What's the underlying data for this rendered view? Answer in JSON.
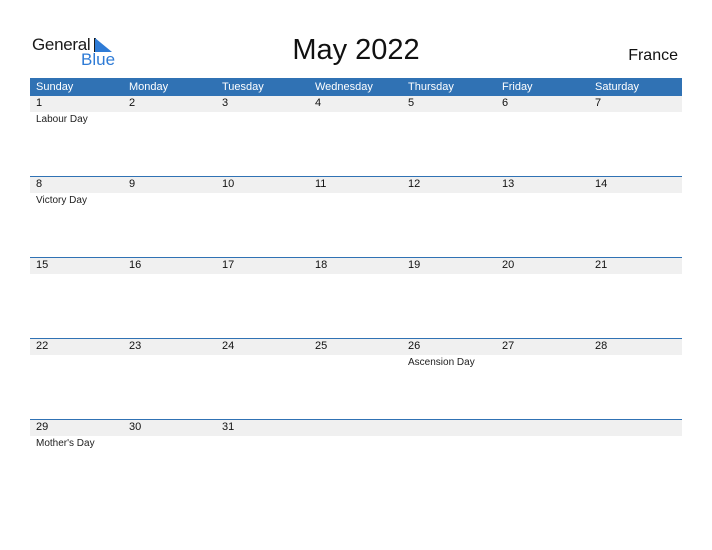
{
  "logo": {
    "line1": "General",
    "line2": "Blue"
  },
  "title": "May 2022",
  "country": "France",
  "colors": {
    "header_bg": "#3072b4",
    "accent": "#2e7bd6",
    "day_row_bg": "#f0f0f0"
  },
  "weekdays": [
    "Sunday",
    "Monday",
    "Tuesday",
    "Wednesday",
    "Thursday",
    "Friday",
    "Saturday"
  ],
  "weeks": [
    [
      {
        "day": "1",
        "event": "Labour Day"
      },
      {
        "day": "2",
        "event": ""
      },
      {
        "day": "3",
        "event": ""
      },
      {
        "day": "4",
        "event": ""
      },
      {
        "day": "5",
        "event": ""
      },
      {
        "day": "6",
        "event": ""
      },
      {
        "day": "7",
        "event": ""
      }
    ],
    [
      {
        "day": "8",
        "event": "Victory Day"
      },
      {
        "day": "9",
        "event": ""
      },
      {
        "day": "10",
        "event": ""
      },
      {
        "day": "11",
        "event": ""
      },
      {
        "day": "12",
        "event": ""
      },
      {
        "day": "13",
        "event": ""
      },
      {
        "day": "14",
        "event": ""
      }
    ],
    [
      {
        "day": "15",
        "event": ""
      },
      {
        "day": "16",
        "event": ""
      },
      {
        "day": "17",
        "event": ""
      },
      {
        "day": "18",
        "event": ""
      },
      {
        "day": "19",
        "event": ""
      },
      {
        "day": "20",
        "event": ""
      },
      {
        "day": "21",
        "event": ""
      }
    ],
    [
      {
        "day": "22",
        "event": ""
      },
      {
        "day": "23",
        "event": ""
      },
      {
        "day": "24",
        "event": ""
      },
      {
        "day": "25",
        "event": ""
      },
      {
        "day": "26",
        "event": "Ascension Day"
      },
      {
        "day": "27",
        "event": ""
      },
      {
        "day": "28",
        "event": ""
      }
    ],
    [
      {
        "day": "29",
        "event": "Mother's Day"
      },
      {
        "day": "30",
        "event": ""
      },
      {
        "day": "31",
        "event": ""
      },
      {
        "day": "",
        "event": ""
      },
      {
        "day": "",
        "event": ""
      },
      {
        "day": "",
        "event": ""
      },
      {
        "day": "",
        "event": ""
      }
    ]
  ]
}
